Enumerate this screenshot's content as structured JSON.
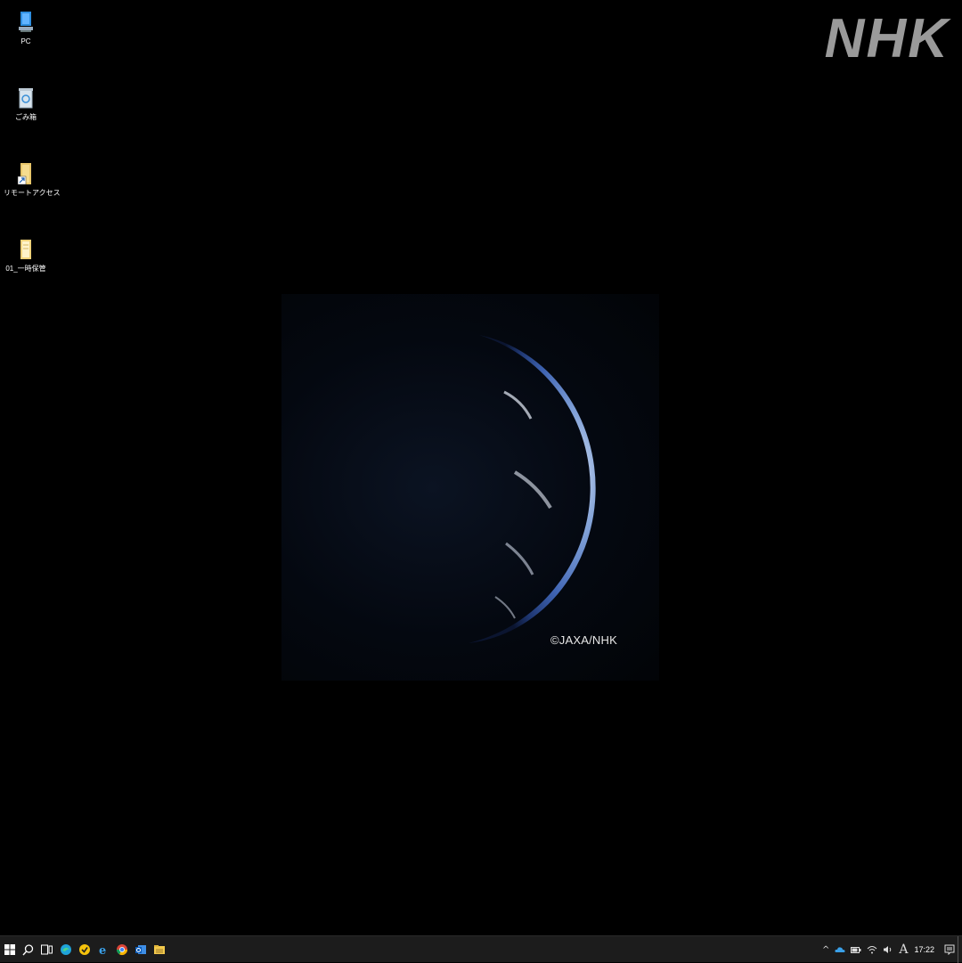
{
  "desktop": {
    "icons": [
      {
        "label": "PC",
        "icon": "pc-icon"
      },
      {
        "label": "ごみ箱",
        "icon": "recycle-bin-icon"
      },
      {
        "label": "リモートアクセス",
        "icon": "shortcut-icon"
      },
      {
        "label": "01_一時保管",
        "icon": "folder-icon"
      }
    ]
  },
  "wallpaper": {
    "credit": "©JAXA/NHK"
  },
  "logo": {
    "text": "NHK"
  },
  "taskbar": {
    "start_icon": "windows-start-icon",
    "search_icon": "search-icon",
    "taskview_icon": "task-view-icon",
    "pinned": [
      "edge-icon",
      "norton-icon",
      "ie-icon",
      "chrome-icon",
      "outlook-icon",
      "file-explorer-icon"
    ],
    "tray": {
      "chevron": "^",
      "ime": "A",
      "time": "17:22"
    }
  }
}
